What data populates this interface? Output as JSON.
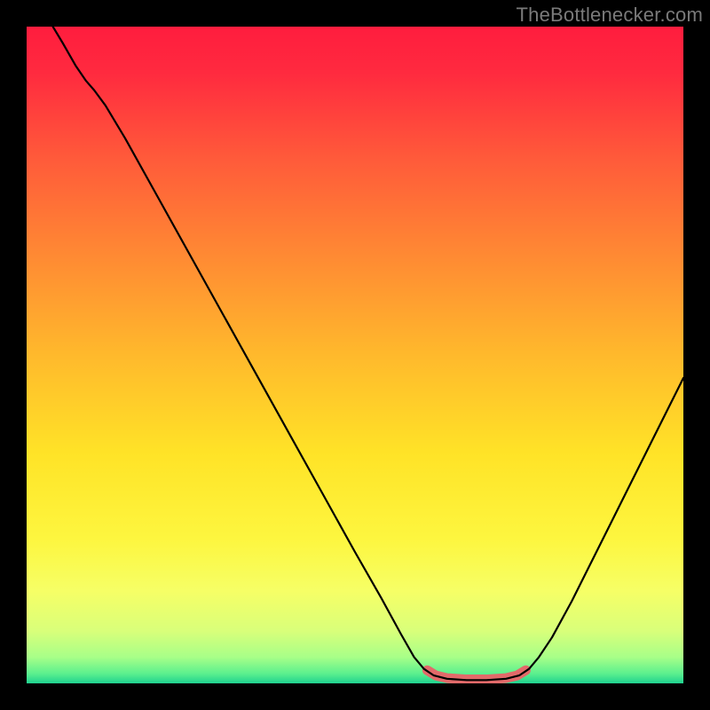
{
  "watermark": "TheBottlenecker.com",
  "chart_data": {
    "type": "line",
    "title": "",
    "xlabel": "",
    "ylabel": "",
    "xlim": [
      0,
      100
    ],
    "ylim": [
      0,
      100
    ],
    "gradient_stops": [
      {
        "offset": 0.0,
        "color": "#ff1d3e"
      },
      {
        "offset": 0.07,
        "color": "#ff2a3f"
      },
      {
        "offset": 0.2,
        "color": "#ff5a3a"
      },
      {
        "offset": 0.35,
        "color": "#ff8a33"
      },
      {
        "offset": 0.5,
        "color": "#ffb92c"
      },
      {
        "offset": 0.65,
        "color": "#ffe327"
      },
      {
        "offset": 0.78,
        "color": "#fdf63f"
      },
      {
        "offset": 0.86,
        "color": "#f6ff66"
      },
      {
        "offset": 0.92,
        "color": "#d9ff7a"
      },
      {
        "offset": 0.96,
        "color": "#a8ff88"
      },
      {
        "offset": 0.985,
        "color": "#5cf08e"
      },
      {
        "offset": 1.0,
        "color": "#1fd18f"
      }
    ],
    "series": [
      {
        "name": "bottleneck-curve",
        "color": "#000000",
        "width": 2.2,
        "points": [
          {
            "x": 4.0,
            "y": 100.0
          },
          {
            "x": 5.5,
            "y": 97.5
          },
          {
            "x": 7.5,
            "y": 94.0
          },
          {
            "x": 9.0,
            "y": 91.8
          },
          {
            "x": 10.3,
            "y": 90.3
          },
          {
            "x": 12.0,
            "y": 88.0
          },
          {
            "x": 15.0,
            "y": 83.0
          },
          {
            "x": 20.0,
            "y": 74.0
          },
          {
            "x": 25.0,
            "y": 65.0
          },
          {
            "x": 30.0,
            "y": 56.0
          },
          {
            "x": 35.0,
            "y": 47.0
          },
          {
            "x": 40.0,
            "y": 38.0
          },
          {
            "x": 45.0,
            "y": 29.0
          },
          {
            "x": 50.0,
            "y": 20.0
          },
          {
            "x": 54.0,
            "y": 13.0
          },
          {
            "x": 57.0,
            "y": 7.5
          },
          {
            "x": 59.0,
            "y": 4.0
          },
          {
            "x": 60.5,
            "y": 2.2
          },
          {
            "x": 62.0,
            "y": 1.2
          },
          {
            "x": 64.0,
            "y": 0.7
          },
          {
            "x": 67.0,
            "y": 0.5
          },
          {
            "x": 70.0,
            "y": 0.5
          },
          {
            "x": 73.0,
            "y": 0.7
          },
          {
            "x": 75.0,
            "y": 1.2
          },
          {
            "x": 76.5,
            "y": 2.2
          },
          {
            "x": 78.0,
            "y": 4.0
          },
          {
            "x": 80.0,
            "y": 7.0
          },
          {
            "x": 83.0,
            "y": 12.5
          },
          {
            "x": 86.0,
            "y": 18.5
          },
          {
            "x": 89.0,
            "y": 24.5
          },
          {
            "x": 92.0,
            "y": 30.5
          },
          {
            "x": 95.0,
            "y": 36.5
          },
          {
            "x": 98.0,
            "y": 42.5
          },
          {
            "x": 100.0,
            "y": 46.5
          }
        ]
      },
      {
        "name": "optimal-zone",
        "stroke": "#e26a6a",
        "stroke_width": 11,
        "points": [
          {
            "x": 61.0,
            "y": 2.0
          },
          {
            "x": 62.3,
            "y": 1.2
          },
          {
            "x": 64.0,
            "y": 0.8
          },
          {
            "x": 67.0,
            "y": 0.6
          },
          {
            "x": 70.0,
            "y": 0.6
          },
          {
            "x": 73.0,
            "y": 0.8
          },
          {
            "x": 74.7,
            "y": 1.2
          },
          {
            "x": 76.0,
            "y": 2.0
          }
        ]
      }
    ]
  }
}
